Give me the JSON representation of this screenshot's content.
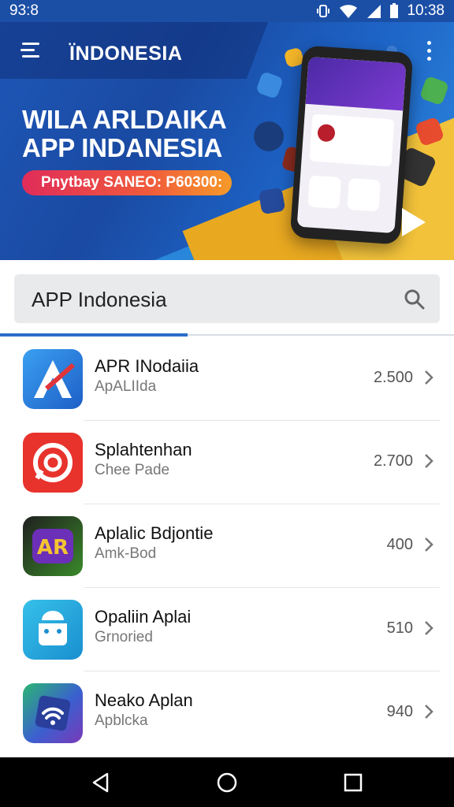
{
  "status": {
    "time_left": "93:8",
    "time_right": "10:38"
  },
  "header": {
    "title": "ÏNDONESIA"
  },
  "banner": {
    "headline_line1": "WILA ARLDAIKA",
    "headline_line2": "APP INDANESIA",
    "promo": "Pnytbay SANEO: P60300:"
  },
  "search": {
    "value": "APP Indonesia"
  },
  "colors": {
    "brand_blue": "#1b4fa6",
    "accent_orange": "#f59a2a",
    "accent_pink": "#e02c5a",
    "tab_indicator": "#2a6dc8"
  },
  "apps": [
    {
      "name": "APR INodaiia",
      "sub": "ApALIIda",
      "value": "2.500",
      "icon": "stylized-a-icon"
    },
    {
      "name": "Splahtenhan",
      "sub": "Chee Pade",
      "value": "2.700",
      "icon": "target-chat-icon"
    },
    {
      "name": "Aplalic Bdjontie",
      "sub": "Amk-Bod",
      "value": "400",
      "icon": "ar-badge-icon"
    },
    {
      "name": "Opaliin Aplai",
      "sub": "Grnoried",
      "value": "510",
      "icon": "android-robot-icon"
    },
    {
      "name": "Neako Aplan",
      "sub": "Apblcka",
      "value": "940",
      "icon": "wifi-shield-icon"
    }
  ],
  "nav": {
    "back": "back-icon",
    "home": "home-icon",
    "recents": "recents-icon"
  }
}
